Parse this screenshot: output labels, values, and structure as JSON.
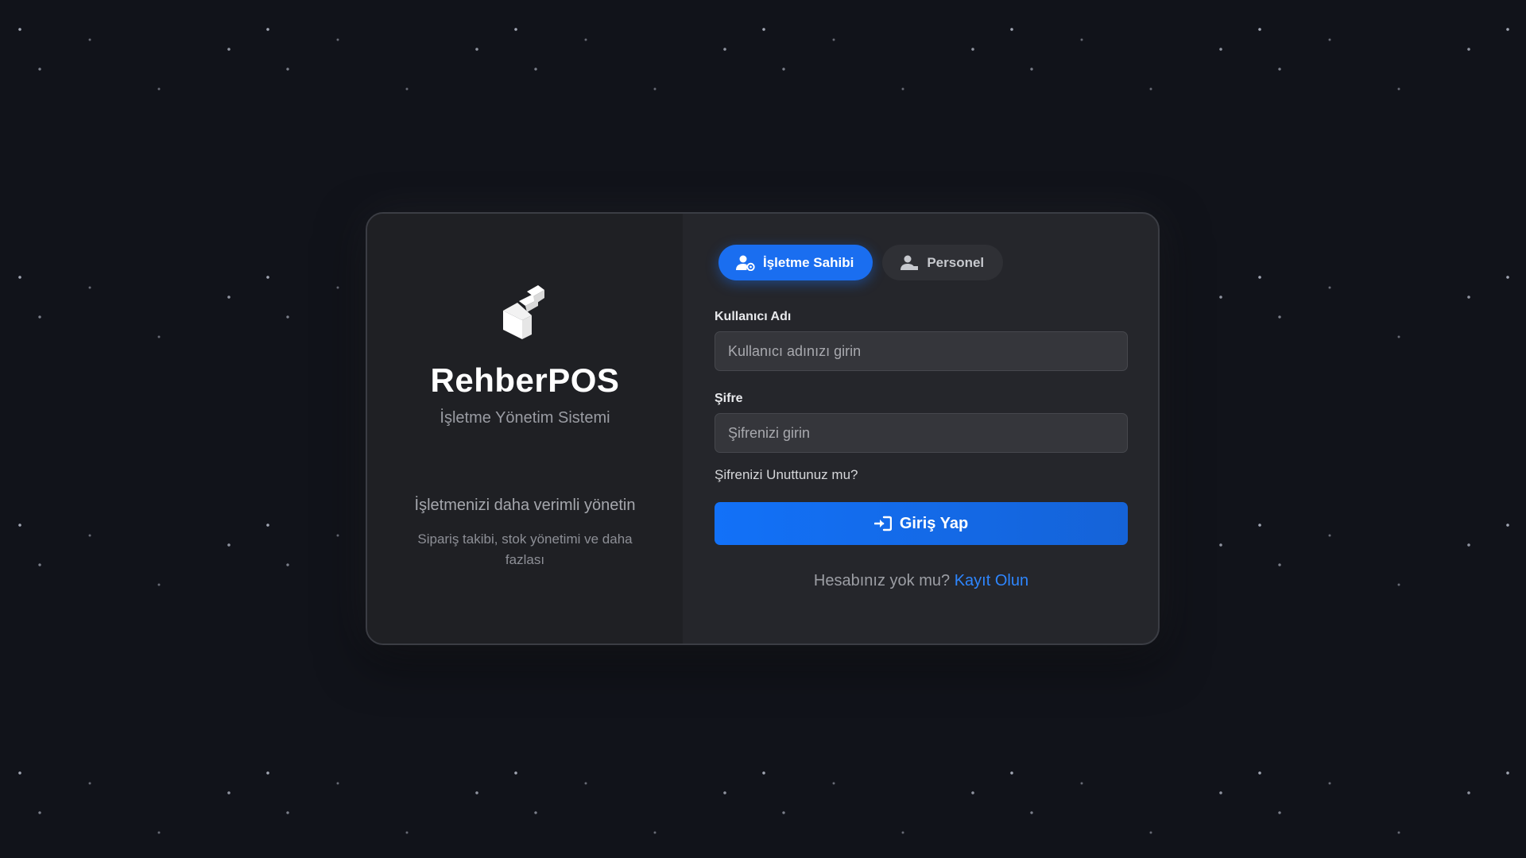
{
  "brand": {
    "name": "RehberPOS",
    "subtitle": "İşletme Yönetim Sistemi",
    "tagline": "İşletmenizi daha verimli yönetin",
    "description": "Sipariş takibi, stok yönetimi ve daha fazlası"
  },
  "tabs": [
    {
      "label": "İşletme Sahibi",
      "icon": "user-gear-icon",
      "active": true
    },
    {
      "label": "Personel",
      "icon": "user-icon",
      "active": false
    }
  ],
  "form": {
    "username_label": "Kullanıcı Adı",
    "username_placeholder": "Kullanıcı adınızı girin",
    "password_label": "Şifre",
    "password_placeholder": "Şifrenizi girin",
    "forgot_link": "Şifrenizi Unuttunuz mu?",
    "login_button": "Giriş Yap",
    "login_icon": "sign-in-icon",
    "register_prompt": "Hesabınız yok mu?",
    "register_link": "Kayıt Olun"
  },
  "colors": {
    "accent": "#1a6ef0",
    "link": "#2e86ff",
    "background": "#11131a",
    "card": "#25262b"
  }
}
